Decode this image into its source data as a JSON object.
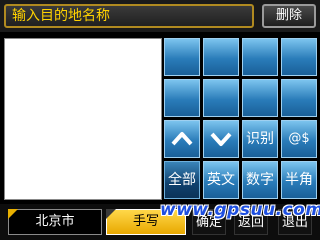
{
  "search": {
    "placeholder_text": "输入目的地名称"
  },
  "toolbar": {
    "delete_label": "删除"
  },
  "keypad": {
    "up_icon": "chevron-up-icon",
    "down_icon": "chevron-down-icon",
    "recognize_label": "识别",
    "symbols_label": "@$",
    "all_label": "全部",
    "english_label": "英文",
    "digits_label": "数字",
    "halfwidth_label": "半角"
  },
  "bottom": {
    "city_label": "北京市",
    "handwrite_label": "手写",
    "confirm_label": "确定",
    "back_label": "返回",
    "exit_label": "退出"
  },
  "watermark": {
    "text": "www.gpsuu.com"
  },
  "colors": {
    "accent_yellow": "#ffd200",
    "key_blue": "#2a7cb9",
    "watermark_blue": "#1e4fe0"
  }
}
